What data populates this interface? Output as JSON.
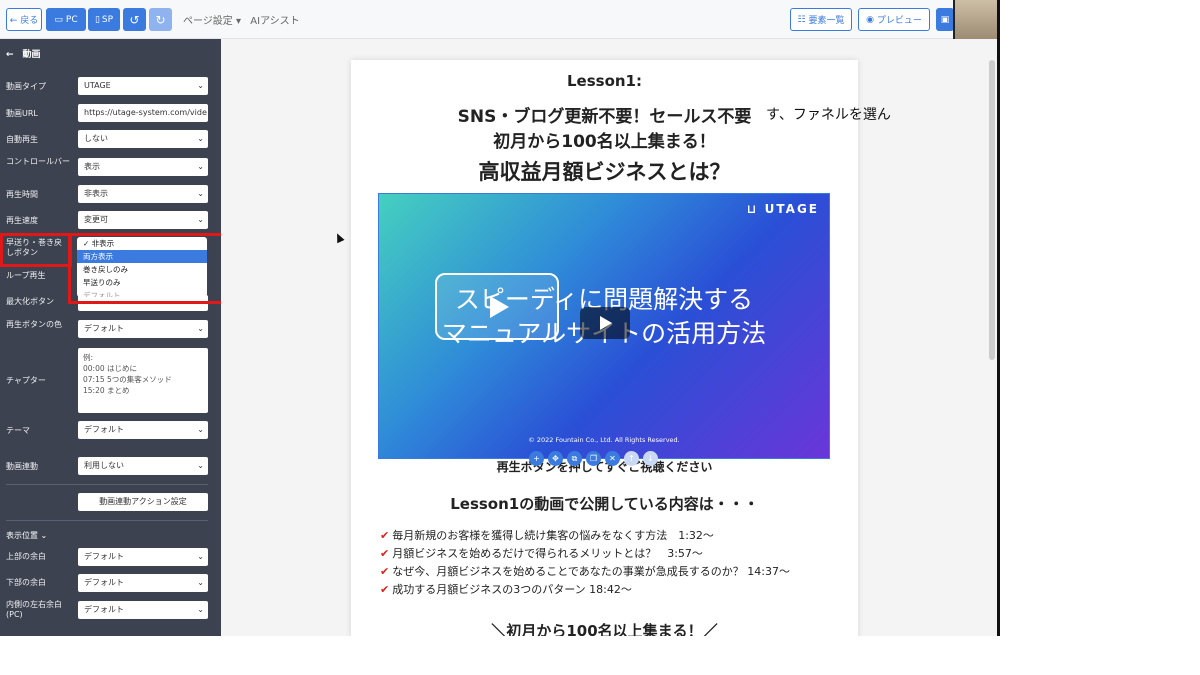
{
  "toolbar": {
    "back_label": "← 戻る",
    "pc_label": "PC",
    "sp_label": "SP",
    "undo_icon": "↺",
    "redo_icon": "↻",
    "page_settings_label": "ページ設定 ▾",
    "ai_assist_label": "AIアシスト",
    "elements_list_label": "要素一覧",
    "preview_label": "プレビュー",
    "save_icon": "▣"
  },
  "sidebar": {
    "back_title": "←　動画",
    "fields": [
      {
        "label": "動画タイプ",
        "value": "UTAGE"
      },
      {
        "label": "動画URL",
        "value": "https://utage-system.com/vide"
      },
      {
        "label": "自動再生",
        "value": "しない"
      },
      {
        "label": "コントロールバー",
        "value": "表示"
      },
      {
        "label": "再生時間",
        "value": "非表示"
      },
      {
        "label": "再生速度",
        "value": "変更可"
      },
      {
        "label": "早送り・巻き戻しボタン",
        "value": ""
      },
      {
        "label": "ループ再生",
        "value": ""
      },
      {
        "label": "最大化ボタン",
        "value": ""
      },
      {
        "label": "再生ボタンの色",
        "value": "デフォルト"
      }
    ],
    "chapter_label": "チャプター",
    "chapter_text": [
      "例:",
      "00:00 はじめに",
      "07:15 5つの集客メソッド",
      "15:20 まとめ"
    ],
    "theme_label": "テーマ",
    "theme_value": "デフォルト",
    "video_link_label": "動画連動",
    "video_link_value": "利用しない",
    "action_button_label": "動画連動アクション設定",
    "position_label": "表示位置 ⌄",
    "margin_fields": [
      {
        "label": "上部の余白",
        "value": "デフォルト"
      },
      {
        "label": "下部の余白",
        "value": "デフォルト"
      },
      {
        "label": "内側の左右余白(PC)",
        "value": "デフォルト"
      }
    ],
    "dropdown_options": [
      "✓ 非表示",
      "両方表示",
      "巻き戻しのみ",
      "早送りのみ",
      "デフォルト"
    ],
    "dropdown_highlight": "両方表示"
  },
  "page": {
    "lesson_title": "Lesson1:",
    "headline1": "SNS・ブログ更新不要！セールス不要",
    "headline2": "初月から100名以上集まる！",
    "headline3": "高収益月額ビジネスとは？",
    "video_logo": "UTAGE",
    "video_line1": "スピーディに問題解決する",
    "video_line2": "マニュアルサイトの活用方法",
    "video_copyright": "© 2022 Fountain Co., Ltd. All Rights Reserved.",
    "video_caption": "再生ボタンを押してすぐご視聴ください",
    "section_title": "Lesson1の動画で公開している内容は・・・",
    "bullets": [
      "毎月新規のお客様を獲得し続け集客の悩みをなくす方法　1:32〜",
      "月額ビジネスを始めるだけで得られるメリットとは？　3:57〜",
      "なぜ今、月額ビジネスを始めることであなたの事業が急成長するのか？ 14:37〜",
      "成功する月額ビジネスの3つのパターン 18:42〜"
    ],
    "bottom_heading": "＼初月から100名以上集まる！／"
  },
  "overlay_caption": "す、ファネルを選ん",
  "colors": {
    "accent": "#3b7be0",
    "sidebar": "#3c4250",
    "highlight_box": "#e01818"
  }
}
